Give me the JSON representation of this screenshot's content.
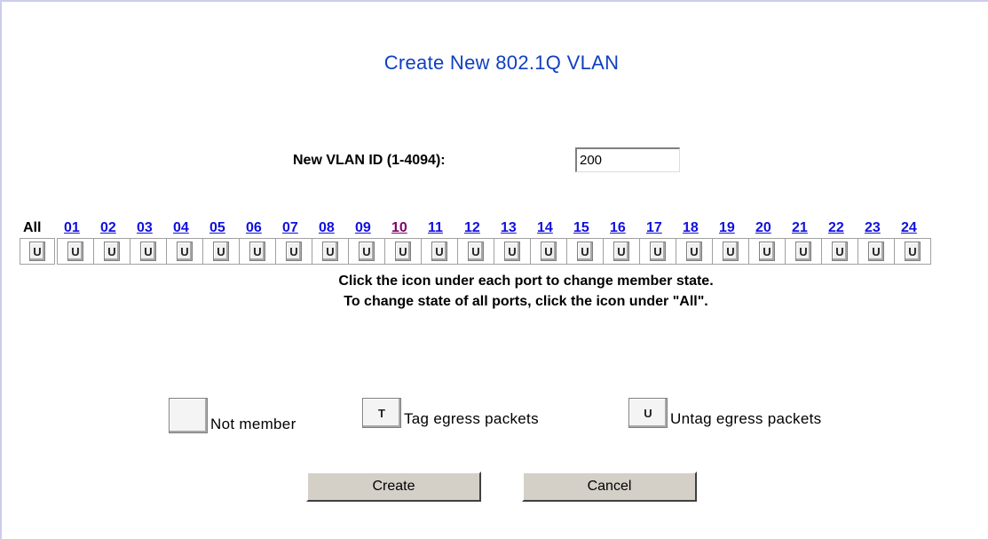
{
  "title": "Create New 802.1Q VLAN",
  "vlan_id": {
    "label": "New VLAN ID (1-4094):",
    "value": "200"
  },
  "ports": {
    "all_label": "All",
    "all_state": "U",
    "items": [
      {
        "label": "01",
        "state": "U"
      },
      {
        "label": "02",
        "state": "U"
      },
      {
        "label": "03",
        "state": "U"
      },
      {
        "label": "04",
        "state": "U"
      },
      {
        "label": "05",
        "state": "U"
      },
      {
        "label": "06",
        "state": "U"
      },
      {
        "label": "07",
        "state": "U"
      },
      {
        "label": "08",
        "state": "U"
      },
      {
        "label": "09",
        "state": "U"
      },
      {
        "label": "10",
        "state": "U",
        "visited": true
      },
      {
        "label": "11",
        "state": "U"
      },
      {
        "label": "12",
        "state": "U"
      },
      {
        "label": "13",
        "state": "U"
      },
      {
        "label": "14",
        "state": "U"
      },
      {
        "label": "15",
        "state": "U"
      },
      {
        "label": "16",
        "state": "U"
      },
      {
        "label": "17",
        "state": "U"
      },
      {
        "label": "18",
        "state": "U"
      },
      {
        "label": "19",
        "state": "U"
      },
      {
        "label": "20",
        "state": "U"
      },
      {
        "label": "21",
        "state": "U"
      },
      {
        "label": "22",
        "state": "U"
      },
      {
        "label": "23",
        "state": "U"
      },
      {
        "label": "24",
        "state": "U"
      }
    ]
  },
  "instructions": {
    "line1": "Click the icon under each port to change member state.",
    "line2": "To change state of all ports, click the icon under \"All\"."
  },
  "legend": {
    "not_member": {
      "icon": "",
      "text": "Not member"
    },
    "tag": {
      "icon": "T",
      "text": "Tag egress packets"
    },
    "untag": {
      "icon": "U",
      "text": "Untag egress packets"
    }
  },
  "buttons": {
    "create": "Create",
    "cancel": "Cancel"
  },
  "colors": {
    "title": "#1040c0",
    "link": "#1010e0",
    "visited_link": "#800070",
    "button_face": "#d4d0c8"
  }
}
